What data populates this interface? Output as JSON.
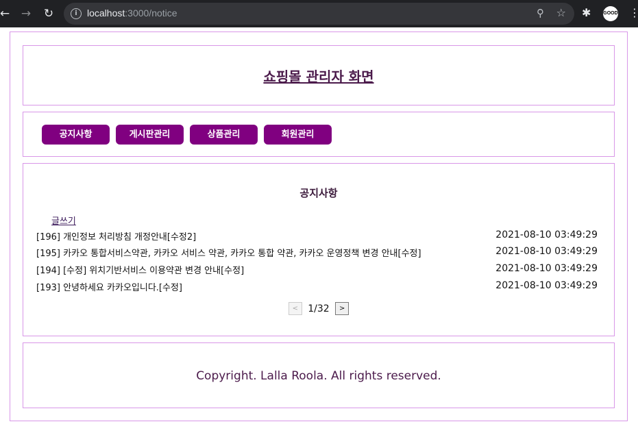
{
  "browser": {
    "url_host": "localhost",
    "url_path": ":3000/notice",
    "profile_label": "GOOD"
  },
  "header": {
    "title": "쇼핑몰 관리자 화면"
  },
  "menu": {
    "items": [
      {
        "label": "공지사항"
      },
      {
        "label": "게시판관리"
      },
      {
        "label": "상품관리"
      },
      {
        "label": "회원관리"
      }
    ]
  },
  "notice": {
    "title": "공지사항",
    "write_link": "글쓰기",
    "rows": [
      {
        "subject": "[196] 개인정보 처리방침 개정안내[수정2]",
        "date": "2021-08-10 03:49:29"
      },
      {
        "subject": "[195] 카카오 통합서비스약관, 카카오 서비스 약관, 카카오 통합 약관, 카카오 운영정책 변경 안내[수정]",
        "date": "2021-08-10 03:49:29"
      },
      {
        "subject": "[194] [수정] 위치기반서비스 이용약관 변경 안내[수정]",
        "date": "2021-08-10 03:49:29"
      },
      {
        "subject": "[193] 안녕하세요 카카오입니다.[수정]",
        "date": "2021-08-10 03:49:29"
      }
    ],
    "pager": {
      "prev": "<",
      "next": ">",
      "count": "1/32"
    }
  },
  "footer": {
    "copyright": "Copyright. Lalla Roola. All rights reserved."
  }
}
